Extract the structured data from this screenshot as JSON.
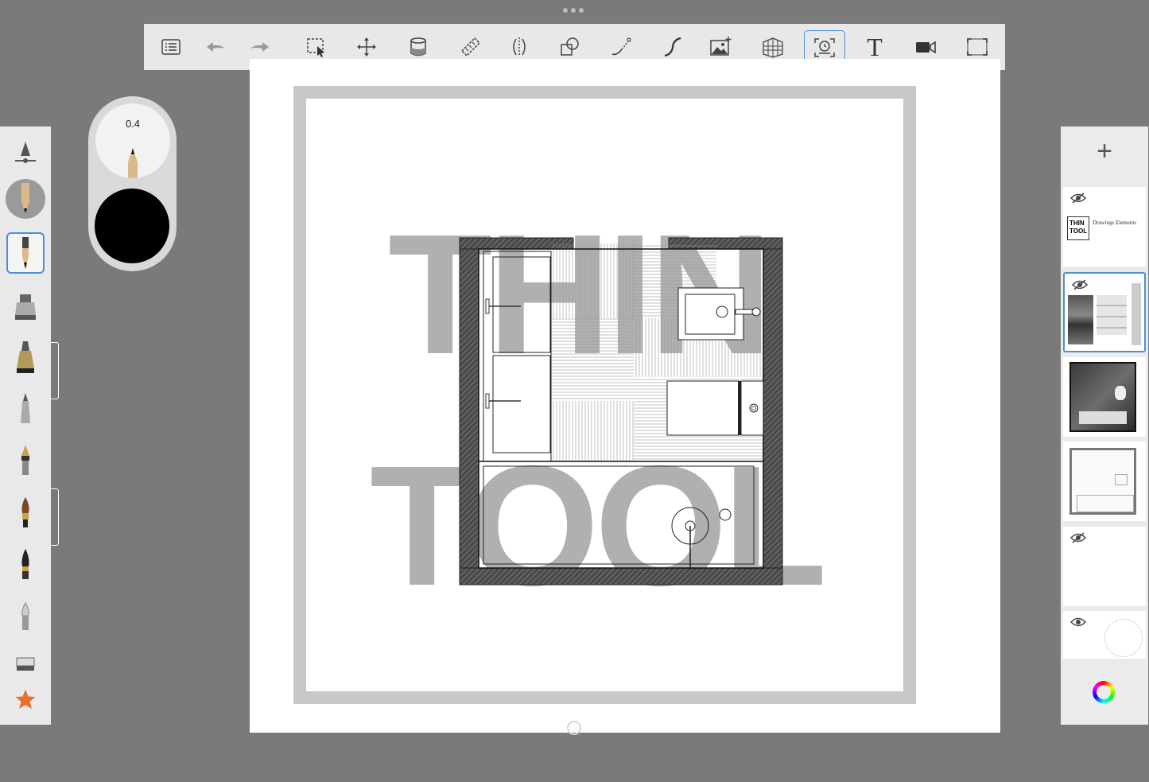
{
  "toolbar": {
    "tools": [
      {
        "name": "list-icon"
      },
      {
        "name": "undo-icon"
      },
      {
        "name": "redo-icon"
      },
      {
        "name": "selection-icon"
      },
      {
        "name": "transform-icon"
      },
      {
        "name": "fill-bucket-icon"
      },
      {
        "name": "ruler-icon"
      },
      {
        "name": "symmetry-icon"
      },
      {
        "name": "shapes-icon"
      },
      {
        "name": "curve-icon"
      },
      {
        "name": "stroke-icon"
      },
      {
        "name": "image-add-icon"
      },
      {
        "name": "perspective-grid-icon"
      },
      {
        "name": "timelapse-icon",
        "active": true
      },
      {
        "name": "text-icon",
        "label": "T"
      },
      {
        "name": "record-icon"
      },
      {
        "name": "fullscreen-icon"
      }
    ]
  },
  "brush_panel": {
    "size": "0.4",
    "color": "#000000"
  },
  "canvas": {
    "word1": "THIN",
    "word2": "TOOL"
  },
  "layers": [
    {
      "visible": false,
      "thumb_logo_line1": "THIN",
      "thumb_logo_line2": "TOOL",
      "thumb_text": "Drawings Elements"
    },
    {
      "visible": false,
      "selected": true
    },
    {
      "visible": false
    },
    {
      "visible": true
    },
    {
      "visible": false
    },
    {
      "visible": true
    }
  ],
  "right_panel": {
    "add_label": "+"
  },
  "colors": {
    "accent": "#4a90d9",
    "background": "#7a7a7a",
    "toolbar": "#e8e8e8"
  }
}
